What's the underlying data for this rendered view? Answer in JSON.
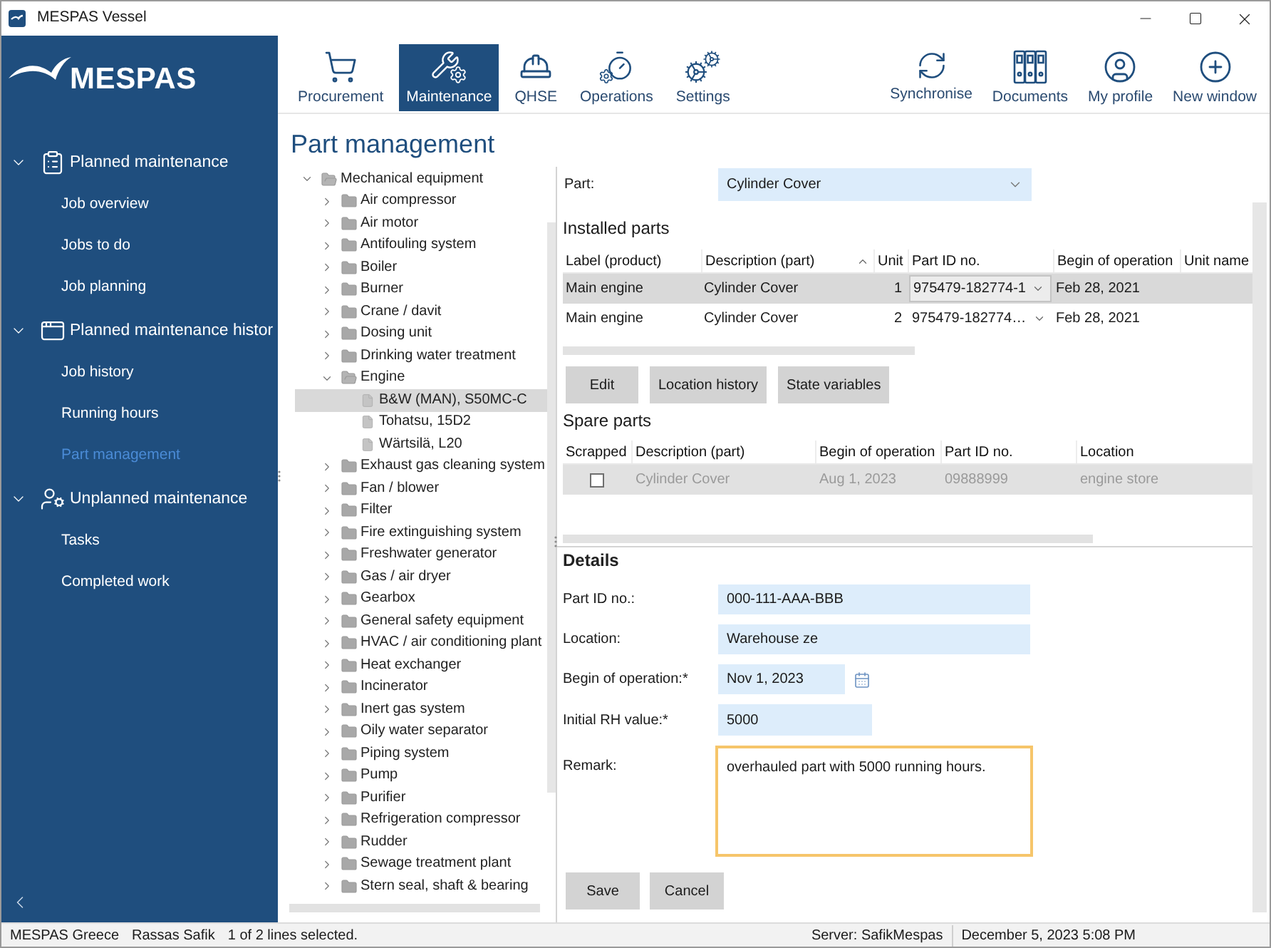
{
  "window": {
    "title": "MESPAS Vessel"
  },
  "sidebar": {
    "logo": "MESPAS",
    "sections": [
      {
        "label": "Planned maintenance",
        "expanded": true,
        "items": [
          {
            "label": "Job overview",
            "selected": false
          },
          {
            "label": "Jobs to do",
            "selected": false
          },
          {
            "label": "Job planning",
            "selected": false
          }
        ]
      },
      {
        "label": "Planned maintenance histor",
        "expanded": true,
        "items": [
          {
            "label": "Job history",
            "selected": false
          },
          {
            "label": "Running hours",
            "selected": false
          },
          {
            "label": "Part management",
            "selected": true
          }
        ]
      },
      {
        "label": "Unplanned maintenance",
        "expanded": true,
        "items": [
          {
            "label": "Tasks",
            "selected": false
          },
          {
            "label": "Completed work",
            "selected": false
          }
        ]
      }
    ]
  },
  "toolbar": {
    "modules": [
      {
        "label": "Procurement",
        "selected": false
      },
      {
        "label": "Maintenance",
        "selected": true
      },
      {
        "label": "QHSE",
        "selected": false
      },
      {
        "label": "Operations",
        "selected": false
      },
      {
        "label": "Settings",
        "selected": false
      }
    ],
    "actions": [
      {
        "label": "Synchronise"
      },
      {
        "label": "Documents"
      },
      {
        "label": "My profile"
      },
      {
        "label": "New window"
      }
    ]
  },
  "page_title": "Part management",
  "tree": [
    {
      "label": "Mechanical equipment",
      "kind": "folder",
      "expanded": true,
      "selected": false,
      "children": [
        {
          "label": "Air compressor",
          "kind": "folder",
          "expanded": false,
          "selected": false
        },
        {
          "label": "Air motor",
          "kind": "folder",
          "expanded": false,
          "selected": false
        },
        {
          "label": "Antifouling system",
          "kind": "folder",
          "expanded": false,
          "selected": false
        },
        {
          "label": "Boiler",
          "kind": "folder",
          "expanded": false,
          "selected": false
        },
        {
          "label": "Burner",
          "kind": "folder",
          "expanded": false,
          "selected": false
        },
        {
          "label": "Crane / davit",
          "kind": "folder",
          "expanded": false,
          "selected": false
        },
        {
          "label": "Dosing unit",
          "kind": "folder",
          "expanded": false,
          "selected": false
        },
        {
          "label": "Drinking water treatment",
          "kind": "folder",
          "expanded": false,
          "selected": false
        },
        {
          "label": "Engine",
          "kind": "folder",
          "expanded": true,
          "selected": false,
          "children": [
            {
              "label": "B&W (MAN), S50MC-C",
              "kind": "part",
              "selected": true
            },
            {
              "label": "Tohatsu, 15D2",
              "kind": "part",
              "selected": false
            },
            {
              "label": "Wärtsilä, L20",
              "kind": "part",
              "selected": false
            }
          ]
        },
        {
          "label": "Exhaust gas cleaning system",
          "kind": "folder",
          "expanded": false,
          "selected": false
        },
        {
          "label": "Fan / blower",
          "kind": "folder",
          "expanded": false,
          "selected": false
        },
        {
          "label": "Filter",
          "kind": "folder",
          "expanded": false,
          "selected": false
        },
        {
          "label": "Fire extinguishing system",
          "kind": "folder",
          "expanded": false,
          "selected": false
        },
        {
          "label": "Freshwater generator",
          "kind": "folder",
          "expanded": false,
          "selected": false
        },
        {
          "label": "Gas / air dryer",
          "kind": "folder",
          "expanded": false,
          "selected": false
        },
        {
          "label": "Gearbox",
          "kind": "folder",
          "expanded": false,
          "selected": false
        },
        {
          "label": "General safety equipment",
          "kind": "folder",
          "expanded": false,
          "selected": false
        },
        {
          "label": "HVAC / air conditioning plant",
          "kind": "folder",
          "expanded": false,
          "selected": false
        },
        {
          "label": "Heat exchanger",
          "kind": "folder",
          "expanded": false,
          "selected": false
        },
        {
          "label": "Incinerator",
          "kind": "folder",
          "expanded": false,
          "selected": false
        },
        {
          "label": "Inert gas system",
          "kind": "folder",
          "expanded": false,
          "selected": false
        },
        {
          "label": "Oily water separator",
          "kind": "folder",
          "expanded": false,
          "selected": false
        },
        {
          "label": "Piping system",
          "kind": "folder",
          "expanded": false,
          "selected": false
        },
        {
          "label": "Pump",
          "kind": "folder",
          "expanded": false,
          "selected": false
        },
        {
          "label": "Purifier",
          "kind": "folder",
          "expanded": false,
          "selected": false
        },
        {
          "label": "Refrigeration compressor",
          "kind": "folder",
          "expanded": false,
          "selected": false
        },
        {
          "label": "Rudder",
          "kind": "folder",
          "expanded": false,
          "selected": false
        },
        {
          "label": "Sewage treatment plant",
          "kind": "folder",
          "expanded": false,
          "selected": false
        },
        {
          "label": "Stern seal, shaft & bearing",
          "kind": "folder",
          "expanded": false,
          "selected": false
        }
      ]
    }
  ],
  "part_selector": {
    "label": "Part:",
    "value": "Cylinder Cover"
  },
  "installed_parts": {
    "title": "Installed parts",
    "columns": [
      {
        "label": "Label (product)",
        "sorted": false
      },
      {
        "label": "Description (part)",
        "sorted": true
      },
      {
        "label": "Unit",
        "sorted": false
      },
      {
        "label": "Part ID no.",
        "sorted": false
      },
      {
        "label": "Begin of operation",
        "sorted": false
      },
      {
        "label": "Unit name",
        "sorted": false
      }
    ],
    "rows": [
      {
        "selected": true,
        "cells": [
          "Main engine",
          "Cylinder Cover",
          "1",
          "975479-182774-1",
          "Feb 28, 2021"
        ]
      },
      {
        "selected": false,
        "cells": [
          "Main engine",
          "Cylinder Cover",
          "2",
          "975479-182774…",
          "Feb 28, 2021"
        ]
      }
    ],
    "buttons": [
      "Edit",
      "Location history",
      "State variables"
    ]
  },
  "spare_parts": {
    "title": "Spare parts",
    "columns": [
      "Scrapped",
      "Description (part)",
      "Begin of operation",
      "Part ID no.",
      "Location"
    ],
    "rows": [
      {
        "disabled": true,
        "cells": [
          {
            "kind": "checkbox",
            "checked": false
          },
          {
            "kind": "text",
            "text": "Cylinder Cover"
          },
          {
            "kind": "text",
            "text": "Aug 1, 2023"
          },
          {
            "kind": "text",
            "text": "09888999"
          },
          {
            "kind": "text",
            "text": "engine store"
          }
        ]
      }
    ]
  },
  "details": {
    "title": "Details",
    "fields": [
      {
        "label": "Part ID no.:",
        "kind": "text",
        "value": "000-111-AAA-BBB",
        "focused": false
      },
      {
        "label": "Location:",
        "kind": "text",
        "value": "Warehouse ze",
        "focused": false
      },
      {
        "label": "Begin of operation:*",
        "kind": "date",
        "value": "Nov 1, 2023",
        "focused": false
      },
      {
        "label": "Initial RH value:*",
        "kind": "number",
        "value": "5000",
        "focused": false
      },
      {
        "label": "Remark:",
        "kind": "textarea",
        "value": "overhauled part with 5000 running hours.",
        "focused": true
      }
    ],
    "buttons": [
      "Save",
      "Cancel"
    ]
  },
  "status_bar": {
    "left": [
      "MESPAS Greece",
      "Rassas Safik",
      "1 of 2 lines selected."
    ],
    "right": [
      "Server: SafikMespas",
      "December 5, 2023 5:08 PM"
    ]
  }
}
